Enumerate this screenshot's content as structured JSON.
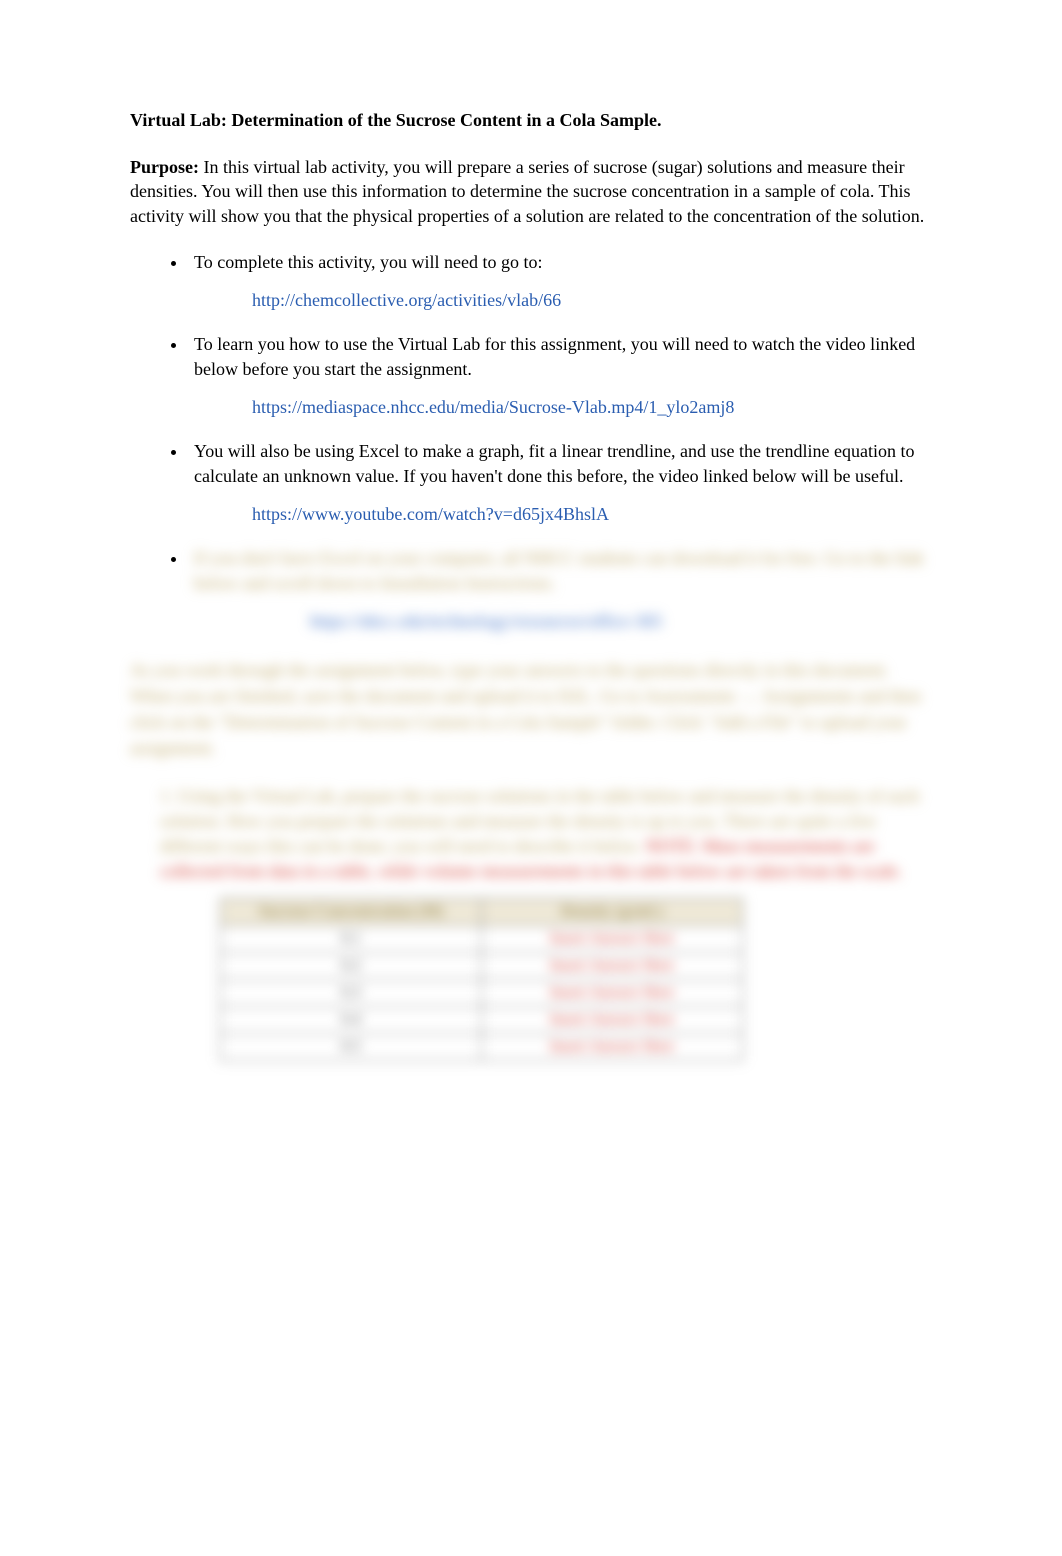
{
  "title": "Virtual Lab: Determination of the Sucrose Content in a Cola Sample.",
  "purpose_label": "Purpose:",
  "purpose_text": "  In this virtual lab activity, you will prepare a series of sucrose (sugar) solutions and measure their densities.  You will then use this information to determine the sucrose concentration in a sample of cola.  This activity will show you that the physical properties of a solution are related to the concentration of the solution.",
  "bullets": [
    {
      "text": "To complete this activity, you will need to go to:",
      "link": "http://chemcollective.org/activities/vlab/66"
    },
    {
      "text": "To learn you how to use the Virtual Lab for this assignment, you will need to watch the video linked below before you start the assignment.",
      "link": "https://mediaspace.nhcc.edu/media/Sucrose-Vlab.mp4/1_ylo2amj8"
    },
    {
      "text": "You will also be using Excel to make a graph, fit a linear trendline, and use the trendline equation to calculate an unknown value.  If you haven't done this before, the video linked below will be useful.",
      "link": "https://www.youtube.com/watch?v=d65jx4BhslA"
    }
  ],
  "blurred": {
    "bullet_text": "If you don't have Excel on your computer, all NHCC students can download it for free.  Go to the link below and scroll down to Installation Instructions.",
    "bullet_link": "https://nhcc.edu/technology/resources/office-365",
    "para": "As you work through the assignment below, type your answers to the questions directly in this document.  When you are finished, save the document and upload it to D2L.  Go to Assessments → Assignments and then click on the \"Determination of Sucrose Content in a Cola Sample\" folder.  Click \"Add a File\" to upload your assignment.",
    "step1_a": "Using the Virtual Lab, prepare the sucrose solutions in the table below and measure the density of each solution.  How you prepare the solutions and measure the density is up to you.  There are quite a few different ways this can be done; you will need to describe it below.  ",
    "step1_b": "NOTE:  Mass measurements are collected from data in a table, while volume measurements in this table below are taken from the scale.",
    "step1_num": "1.  ",
    "table": {
      "head_conc": "Sucrose Concentration (M)",
      "head_dens": "Density (g/mL)",
      "rows": [
        {
          "conc": "0.1",
          "dens": "Insert Answer Here"
        },
        {
          "conc": "0.2",
          "dens": "Insert Answer Here"
        },
        {
          "conc": "0.3",
          "dens": "Insert Answer Here"
        },
        {
          "conc": "0.4",
          "dens": "Insert Answer Here"
        },
        {
          "conc": "0.5",
          "dens": "Insert Answer Here"
        }
      ]
    }
  }
}
